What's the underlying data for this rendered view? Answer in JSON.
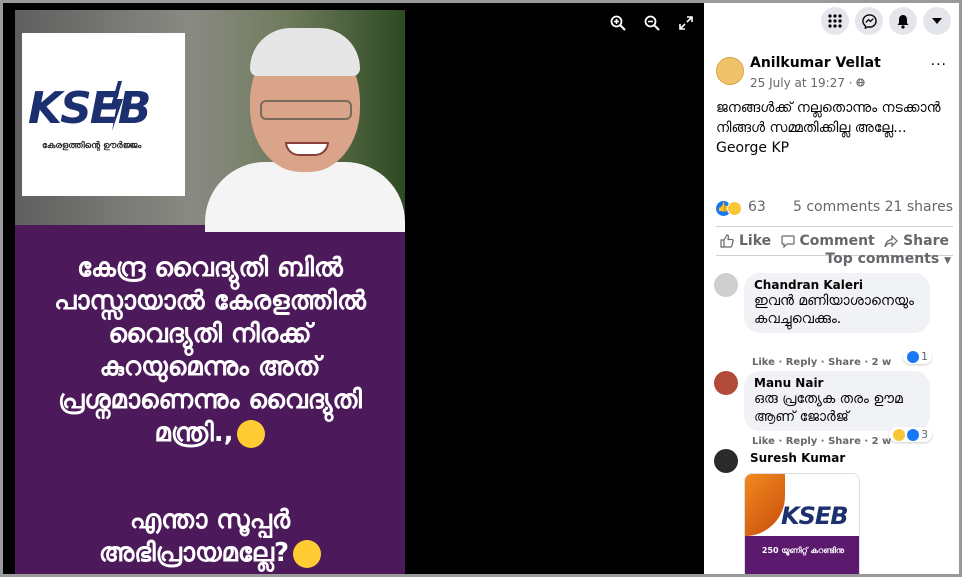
{
  "viewer": {
    "tools": {
      "zoom_in": "zoom-in",
      "zoom_out": "zoom-out",
      "fullscreen": "fullscreen"
    },
    "poster": {
      "logo_text": "KSEB",
      "logo_tagline": "കേരളത്തിന്റെ ഊർജ്ജം",
      "main_text": "കേന്ദ്ര വൈദ്യുതി ബിൽ പാസ്സായാൽ കേരളത്തിൽ വൈദ്യുതി നിരക്ക് കുറയുമെന്നും അത് പ്രശ്നമാണെന്നും വൈദ്യുതി മന്ത്രി.,",
      "second_text": "എന്താ സൂപ്പർ അഭിപ്രായമല്ലേ?"
    }
  },
  "topbar": {
    "icons": [
      "apps-grid-icon",
      "messenger-icon",
      "notifications-icon",
      "account-menu-icon"
    ]
  },
  "post": {
    "author": "Anilkumar Vellat",
    "time": "25 July at 19:27 · ",
    "privacy_icon": "globe-icon",
    "more": "···",
    "text": "ജനങ്ങൾക്ക് നല്ലതൊന്നും നടക്കാൻ നിങ്ങൾ സമ്മതിക്കില്ല അല്ലേ... George KP",
    "reaction_count": "63",
    "comments_count": "5 comments",
    "shares_count": "21 shares",
    "actions": {
      "like": "Like",
      "comment": "Comment",
      "share": "Share"
    },
    "sort_label": "Top comments"
  },
  "comments": [
    {
      "name": "Chandran Kaleri",
      "text": "ഇവൻ മണിയാശാനെയും കവച്ചുവെക്കും.",
      "meta": "Like · Reply · Share · 2 w",
      "reactions": "1"
    },
    {
      "name": "Manu Nair",
      "text": "ഒരു പ്രത്യേക തരം ഊമ ആണ് ജോർജ്",
      "meta": "Like · Reply · Share · 2 w",
      "reactions": "3"
    },
    {
      "name": "Suresh Kumar",
      "attachment_logo": "KSEB",
      "attachment_text": "250 യൂണിറ്റ് കറണ്ടിനു"
    }
  ],
  "colors": {
    "viewer_bg": "#000000",
    "poster_purple": "#4c1a5a",
    "fb_blue": "#1877f2",
    "kseb_navy": "#1c2f6e"
  }
}
